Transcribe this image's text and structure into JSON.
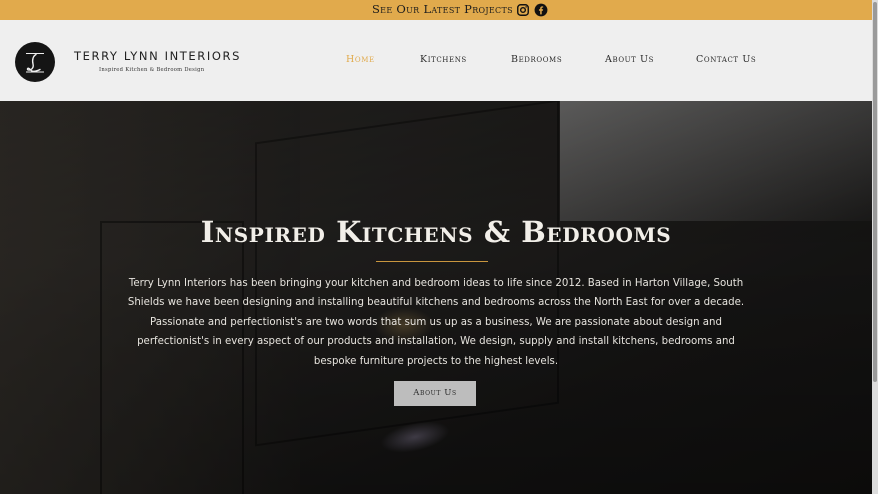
{
  "topbar": {
    "promo_label": "See Our Latest Projects",
    "background": "#e1aa4c",
    "social": [
      {
        "icon": "instagram-icon"
      },
      {
        "icon": "facebook-icon"
      }
    ]
  },
  "header": {
    "brand_name": "TERRY LYNN INTERIORS",
    "brand_tagline": "Inspired Kitchen & Bedroom Design",
    "logo_letter": "L",
    "nav": [
      {
        "label": "Home",
        "active": true
      },
      {
        "label": "Kitchens",
        "active": false
      },
      {
        "label": "Bedrooms",
        "active": false
      },
      {
        "label": "About Us",
        "active": false
      },
      {
        "label": "Contact Us",
        "active": false
      }
    ],
    "accent_color": "#e1aa4c"
  },
  "hero": {
    "title": "Inspired Kitchens & Bedrooms",
    "body": "Terry Lynn Interiors has been bringing your kitchen and bedroom ideas to life since 2012. Based in Harton Village, South Shields we have been designing and installing beautiful kitchens and bedrooms across the North East for over a decade. Passionate and perfectionist's are two words that sum us up as a business, We are passionate about design and perfectionist's in every aspect of our products and installation, We design, supply and install kitchens, bedrooms and bespoke furniture projects to the highest levels.",
    "button_label": "About Us"
  }
}
